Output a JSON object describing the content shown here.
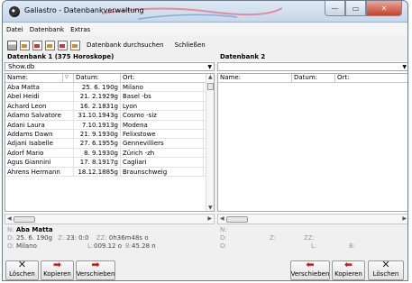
{
  "window": {
    "title": "Galiastro - Datenbankverwaltung",
    "controls": {
      "minimize": "—",
      "maximize": "▭",
      "close": "✕"
    }
  },
  "menu": [
    "Datei",
    "Datenbank",
    "Extras"
  ],
  "toolbar": {
    "icons": [
      "printer-icon",
      "new-document-icon",
      "open-document-icon",
      "save-document-icon",
      "import-icon",
      "export-icon"
    ],
    "search_label": "Datenbank durchsuchen",
    "close_label": "Schließen"
  },
  "left_db": {
    "title": "Datenbank 1 (375 Horoskope)",
    "file": "Show.db",
    "columns": [
      "Name:",
      "▽",
      "Datum:",
      "Ort:"
    ],
    "rows": [
      {
        "name": "Aba Matta",
        "date": "25. 6. 190g",
        "place": "Milano"
      },
      {
        "name": "Abel Heidi",
        "date": "21. 2.1929g",
        "place": "Basel -bs"
      },
      {
        "name": "Achard Leon",
        "date": "16. 2.1831g",
        "place": "Lyon"
      },
      {
        "name": "Adamo Salvatore",
        "date": "31.10.1943g",
        "place": "Cosmo -siz"
      },
      {
        "name": "Adani Laura",
        "date": "7.10.1913g",
        "place": "Modena"
      },
      {
        "name": "Addams Dawn",
        "date": "21. 9.1930g",
        "place": "Felixstowe"
      },
      {
        "name": "Adjani Isabelle",
        "date": "27. 6.1955g",
        "place": "Gennevilliers"
      },
      {
        "name": "Adorf Mario",
        "date": "8. 9.1930g",
        "place": "Zürich -zh"
      },
      {
        "name": "Agus Giannini",
        "date": "17. 8.1917g",
        "place": "Cagliari"
      },
      {
        "name": "Ahrens Hermann",
        "date": "18.12.1885g",
        "place": "Braunschweig"
      }
    ]
  },
  "right_db": {
    "title": "Datenbank 2",
    "file": "",
    "columns": [
      "Name:",
      "Datum:",
      "Ort:"
    ]
  },
  "info_left": {
    "n_key": "N:",
    "name": "Aba Matta",
    "d_key": "D:",
    "date": "25. 6. 190g",
    "z_key": "Z:",
    "time": "23: 0:0",
    "zz_key": "ZZ:",
    "zz_val": "0h36m48s",
    "zz_suffix": "o",
    "o_key": "O:",
    "place": "Milano",
    "l_key": "L:",
    "longitude": "009.12 o",
    "b_key": "B:",
    "latitude": "45.28 n"
  },
  "info_right": {
    "n_key": "N:",
    "d_key": "D:",
    "z_key": "Z:",
    "zz_key": "ZZ:",
    "o_key": "O:",
    "l_key": "L:",
    "b_key": "B:"
  },
  "buttons_left": [
    "Löschen",
    "Kopieren",
    "Verschieben"
  ],
  "buttons_right": [
    "Verschieben",
    "Kopieren",
    "Löschen"
  ]
}
